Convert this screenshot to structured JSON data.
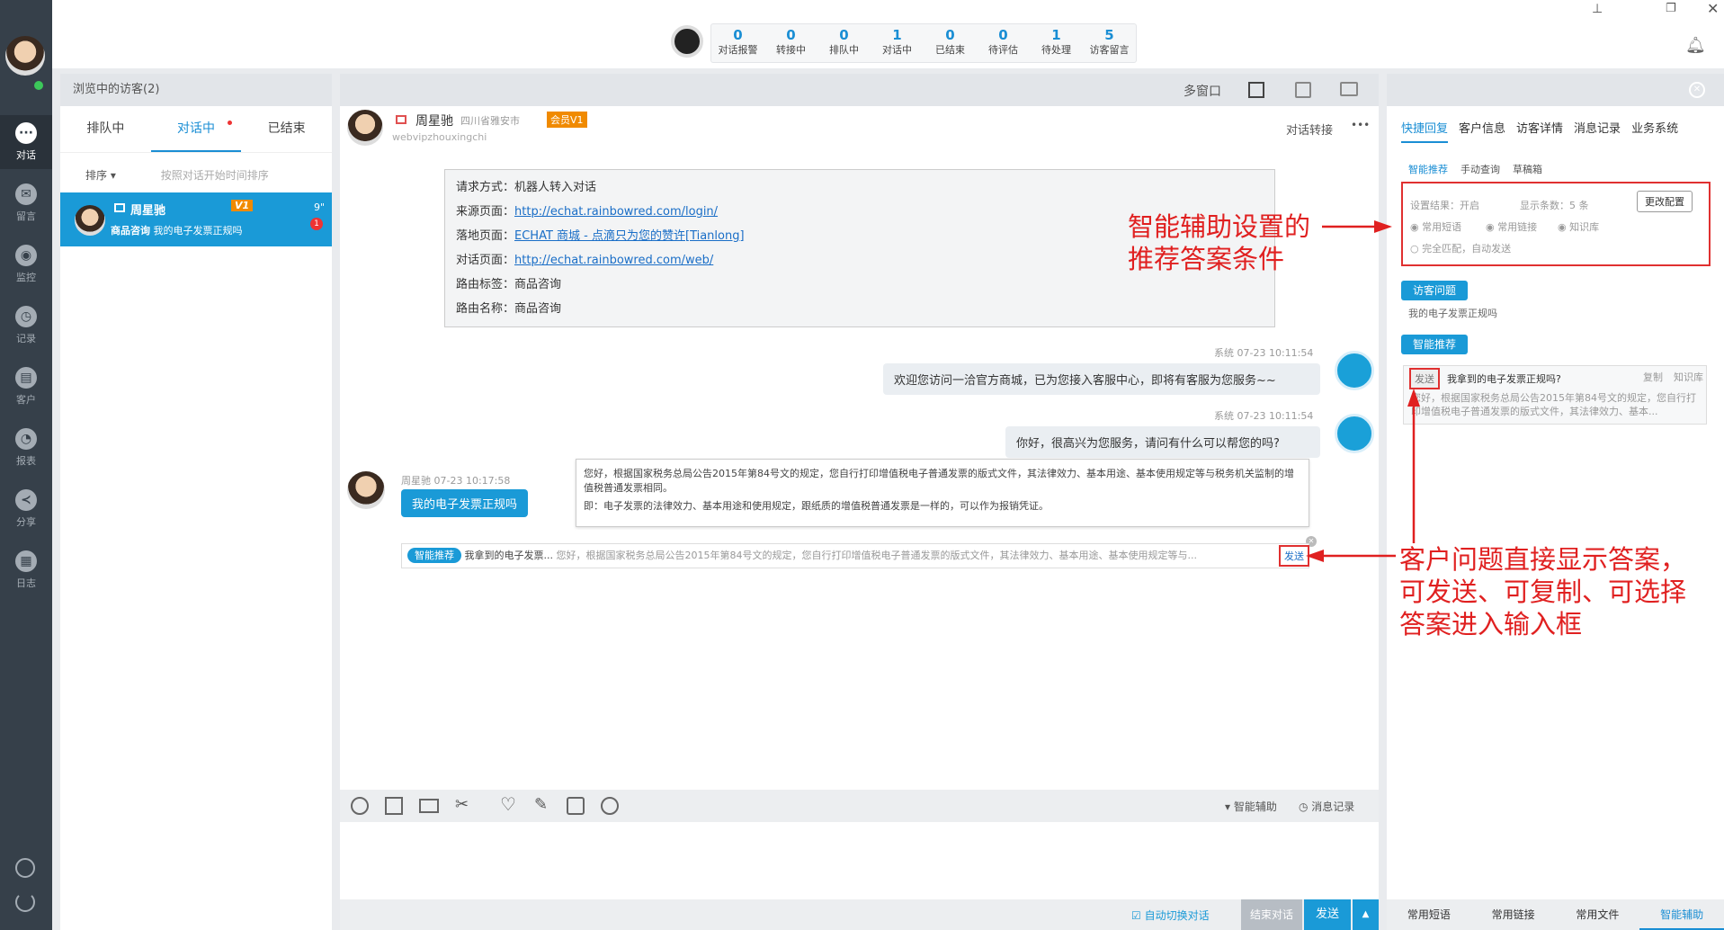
{
  "nav": {
    "items": [
      "对话",
      "留言",
      "监控",
      "记录",
      "客户",
      "报表",
      "分享",
      "日志"
    ]
  },
  "stats": [
    {
      "n": "0",
      "l": "对话报警"
    },
    {
      "n": "0",
      "l": "转接中"
    },
    {
      "n": "0",
      "l": "排队中"
    },
    {
      "n": "1",
      "l": "对话中"
    },
    {
      "n": "0",
      "l": "已结束"
    },
    {
      "n": "0",
      "l": "待评估"
    },
    {
      "n": "1",
      "l": "待处理"
    },
    {
      "n": "5",
      "l": "访客留言"
    }
  ],
  "visitors": {
    "header": "浏览中的访客(2)",
    "tabs": [
      "排队中",
      "对话中",
      "已结束"
    ],
    "sort": "排序",
    "sort_hint": "按照对话开始时间排序",
    "item": {
      "name": "周星驰",
      "level": "V1",
      "time": "9\"",
      "badge": "1",
      "tag": "商品咨询",
      "msg": "我的电子发票正规吗"
    }
  },
  "chat": {
    "toolbar": {
      "multi": "多窗口"
    },
    "visitor": {
      "name": "周星驰",
      "location": "四川省雅安市",
      "member": "会员V1",
      "id": "webvipzhouxingchi",
      "transfer": "对话转接",
      "more": "•••"
    },
    "info": [
      {
        "k": "请求方式：",
        "v": "机器人转入对话"
      },
      {
        "k": "来源页面：",
        "v": "http://echat.rainbowred.com/login/",
        "link": true
      },
      {
        "k": "落地页面：",
        "v": "ECHAT 商城 - 点滴只为您的赞许[Tianlong]",
        "link": true
      },
      {
        "k": "对话页面：",
        "v": "http://echat.rainbowred.com/web/",
        "link": true
      },
      {
        "k": "路由标签：",
        "v": "商品咨询"
      },
      {
        "k": "路由名称：",
        "v": "商品咨询"
      }
    ],
    "msgs": [
      {
        "meta": "系统  07-23 10:11:54",
        "text": "欢迎您访问一洽官方商城，已为您接入客服中心，即将有客服为您服务~~"
      },
      {
        "meta": "系统  07-23 10:11:54",
        "text": "你好，很高兴为您服务，请问有什么可以帮您的吗?"
      }
    ],
    "visitor_msg": {
      "meta": "周星驰  07-23 10:17:58",
      "text": "我的电子发票正规吗"
    },
    "answer": {
      "p1": "您好，根据国家税务总局公告2015年第84号文的规定，您自行打印增值税电子普通发票的版式文件，其法律效力、基本用途、基本使用规定等与税务机关监制的增值税普通发票相同。",
      "p2": "即：电子发票的法律效力、基本用途和使用规定，跟纸质的增值税普通发票是一样的，可以作为报销凭证。"
    },
    "suggest": {
      "tag": "智能推荐",
      "q": "我拿到的电子发票...",
      "a": "您好，根据国家税务总局公告2015年第84号文的规定，您自行打印增值税电子普通发票的版式文件，其法律效力、基本用途、基本使用规定等与...",
      "send": "发送"
    },
    "bottom": {
      "assist": "智能辅助",
      "history": "消息记录",
      "auto": "自动切换对话",
      "end": "结束对话",
      "send": "发送"
    }
  },
  "right": {
    "tabs": [
      "快捷回复",
      "客户信息",
      "访客详情",
      "消息记录",
      "业务系统"
    ],
    "subtabs": [
      "智能推荐",
      "手动查询",
      "草稿箱"
    ],
    "settings": {
      "result_label": "设置结果：",
      "result": "开启",
      "count_label": "显示条数：",
      "count": "5 条",
      "change": "更改配置",
      "opt1": "常用短语",
      "opt2": "常用链接",
      "opt3": "知识库",
      "opt4": "完全匹配，自动发送"
    },
    "visitor_q_btn": "访客问题",
    "visitor_q": "我的电子发票正规吗",
    "smart_btn": "智能推荐",
    "card": {
      "send": "发送",
      "q": "我拿到的电子发票正规吗?",
      "copy": "复制",
      "kb": "知识库",
      "a": "您好，根据国家税务总局公告2015年第84号文的规定，您自行打印增值税电子普通发票的版式文件，其法律效力、基本..."
    },
    "bottom": [
      "常用短语",
      "常用链接",
      "常用文件",
      "智能辅助"
    ]
  },
  "annotations": {
    "a1": [
      "智能辅助设置的",
      "推荐答案条件"
    ],
    "a2": [
      "客户问题直接显示答案，",
      "可发送、可复制、可选择",
      "答案进入输入框"
    ]
  }
}
